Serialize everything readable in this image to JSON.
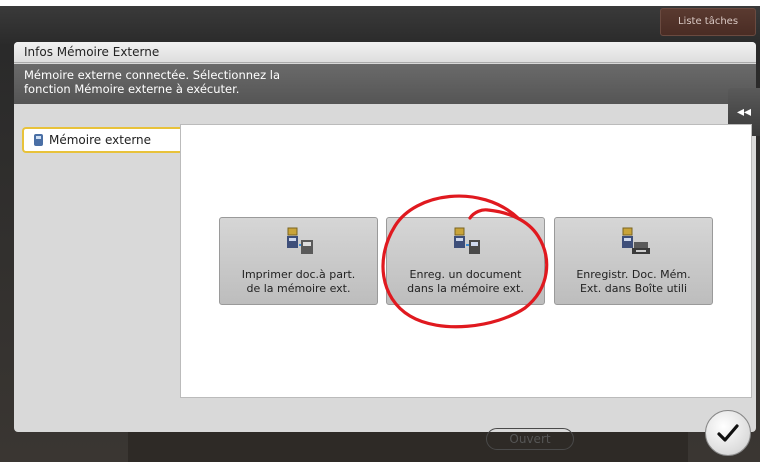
{
  "header": {
    "caption": "—  · · —  · · —",
    "tasks_label": "Liste tâches"
  },
  "dialog": {
    "title": "Infos Mémoire Externe",
    "message_line1": "Mémoire externe connectée. Sélectionnez la",
    "message_line2": "fonction Mémoire externe à exécuter.",
    "collapse_label": "◂◂"
  },
  "sidebar": {
    "tab_label": "Mémoire externe"
  },
  "functions": [
    {
      "label": "Imprimer doc.à part.\nde la mémoire ext.",
      "icon": "print-from-memory-icon"
    },
    {
      "label": "Enreg. un document\ndans la mémoire ext.",
      "icon": "save-to-memory-icon"
    },
    {
      "label": "Enregistr. Doc. Mém.\nExt. dans Boîte utili",
      "icon": "save-to-box-icon"
    }
  ],
  "footer": {
    "ok_label": "Ouvert",
    "confirm_icon": "checkmark-icon"
  },
  "colors": {
    "accent_tab_border": "#e8c23a",
    "annotation": "#e0191f",
    "dialog_bg": "#d9d9d9"
  }
}
